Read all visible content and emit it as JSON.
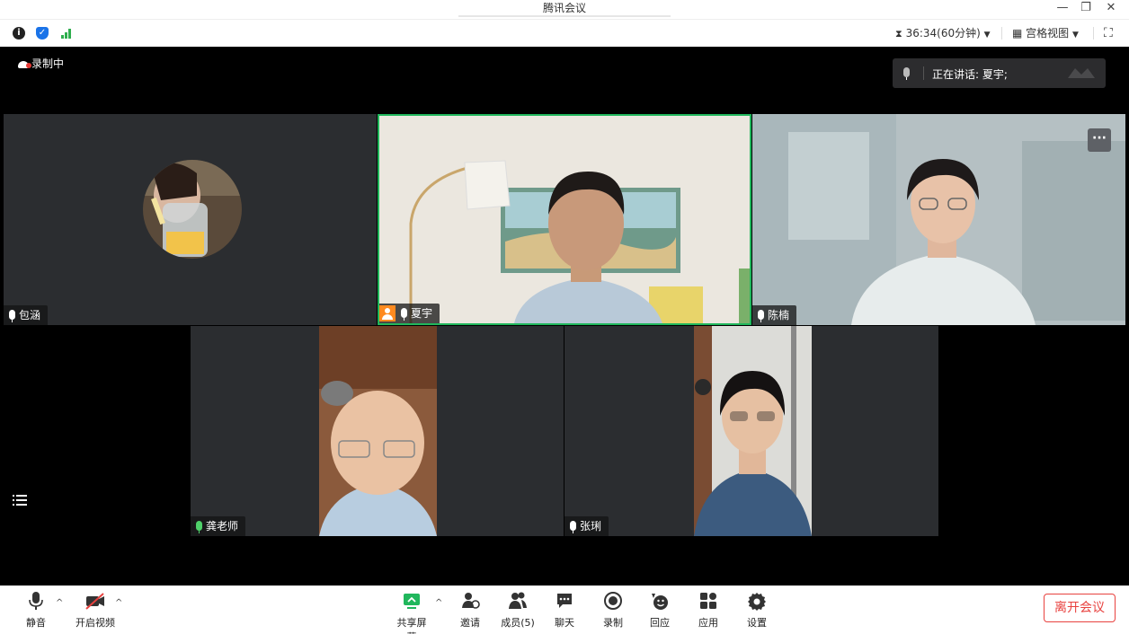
{
  "window": {
    "title": "腾讯会议",
    "minimize": "—",
    "restore": "❐",
    "close": "✕"
  },
  "infobar": {
    "timer": "36:34(60分钟)",
    "view_mode": "宫格视图"
  },
  "stage": {
    "recording_label": "录制中",
    "speaking_label": "正在讲话: 夏宇;"
  },
  "participants": [
    {
      "name": "包涵"
    },
    {
      "name": "夏宇",
      "is_host": true,
      "is_speaking": true
    },
    {
      "name": "陈楠"
    },
    {
      "name": "龚老师"
    },
    {
      "name": "张琍"
    }
  ],
  "toolbar": {
    "mute": "静音",
    "video": "开启视频",
    "share": "共享屏幕",
    "invite": "邀请",
    "members": "成员(5)",
    "chat": "聊天",
    "record": "录制",
    "react": "回应",
    "apps": "应用",
    "settings": "设置",
    "leave": "离开会议"
  },
  "colors": {
    "accent_green": "#20b75c",
    "leave_red": "#e8423f",
    "host_orange": "#ff8a1f",
    "info_blue": "#1a73e8"
  }
}
